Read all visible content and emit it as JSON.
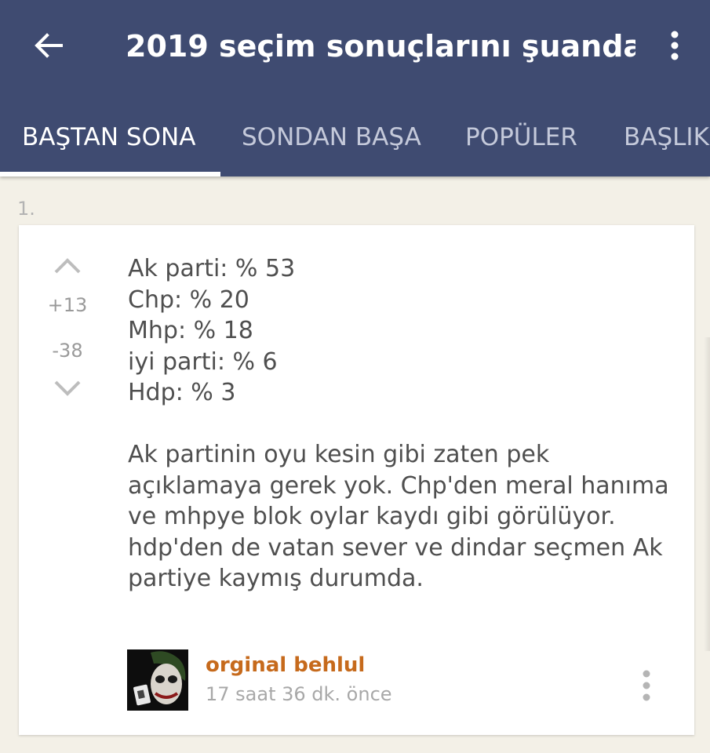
{
  "appbar": {
    "back_icon": "arrow-left-icon",
    "title": "2019 seçim sonuçlarını şuanda...",
    "menu_icon": "more-vertical-icon",
    "background_color": "#3f4b71"
  },
  "tabs": [
    {
      "label": "BAŞTAN SONA",
      "active": true
    },
    {
      "label": "SONDAN BAŞA",
      "active": false
    },
    {
      "label": "POPÜLER",
      "active": false
    },
    {
      "label": "BAŞLIK",
      "active": false
    }
  ],
  "entry": {
    "number": "1.",
    "upvotes": "+13",
    "downvotes": "-38",
    "upvote_icon": "chevron-up-icon",
    "downvote_icon": "chevron-down-icon",
    "results": [
      "Ak parti: % 53",
      "Chp: % 20",
      "Mhp: % 18",
      "iyi parti: % 6",
      "Hdp: % 3"
    ],
    "paragraph_lines": [
      "Ak partinin oyu kesin gibi zaten pek",
      "açıklamaya gerek yok. Chp'den meral hanıma",
      "ve mhpye blok oylar kaydı gibi görülüyor.",
      "hdp'den de vatan sever ve dindar seçmen Ak",
      "partiye kaymış durumda."
    ],
    "author": "orginal behlul",
    "timestamp": "17 saat 36 dk. önce",
    "author_color": "#c66a1c",
    "menu_icon": "more-vertical-icon"
  }
}
